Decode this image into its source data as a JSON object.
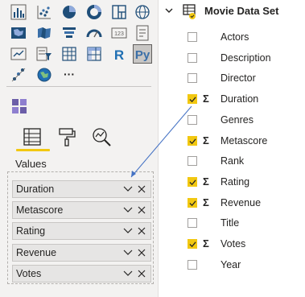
{
  "visualizations": {
    "values_label": "Values",
    "text_glyphs": {
      "r_visual": "R",
      "py_visual": "Py",
      "more": "···"
    }
  },
  "value_fields": [
    {
      "name": "Duration"
    },
    {
      "name": "Metascore"
    },
    {
      "name": "Rating"
    },
    {
      "name": "Revenue"
    },
    {
      "name": "Votes"
    }
  ],
  "fields_pane": {
    "table_name": "Movie Data Set",
    "sigma_glyph": "Σ",
    "fields": [
      {
        "name": "Actors",
        "checked": false,
        "sigma": false
      },
      {
        "name": "Description",
        "checked": false,
        "sigma": false
      },
      {
        "name": "Director",
        "checked": false,
        "sigma": false
      },
      {
        "name": "Duration",
        "checked": true,
        "sigma": true
      },
      {
        "name": "Genres",
        "checked": false,
        "sigma": false
      },
      {
        "name": "Metascore",
        "checked": true,
        "sigma": true
      },
      {
        "name": "Rank",
        "checked": false,
        "sigma": false
      },
      {
        "name": "Rating",
        "checked": true,
        "sigma": true
      },
      {
        "name": "Revenue",
        "checked": true,
        "sigma": true
      },
      {
        "name": "Title",
        "checked": false,
        "sigma": false
      },
      {
        "name": "Votes",
        "checked": true,
        "sigma": true
      },
      {
        "name": "Year",
        "checked": false,
        "sigma": false
      }
    ]
  },
  "colors": {
    "accent": "#f2c811",
    "connector": "#4472c4",
    "pane_bg": "#f3f2f1"
  }
}
